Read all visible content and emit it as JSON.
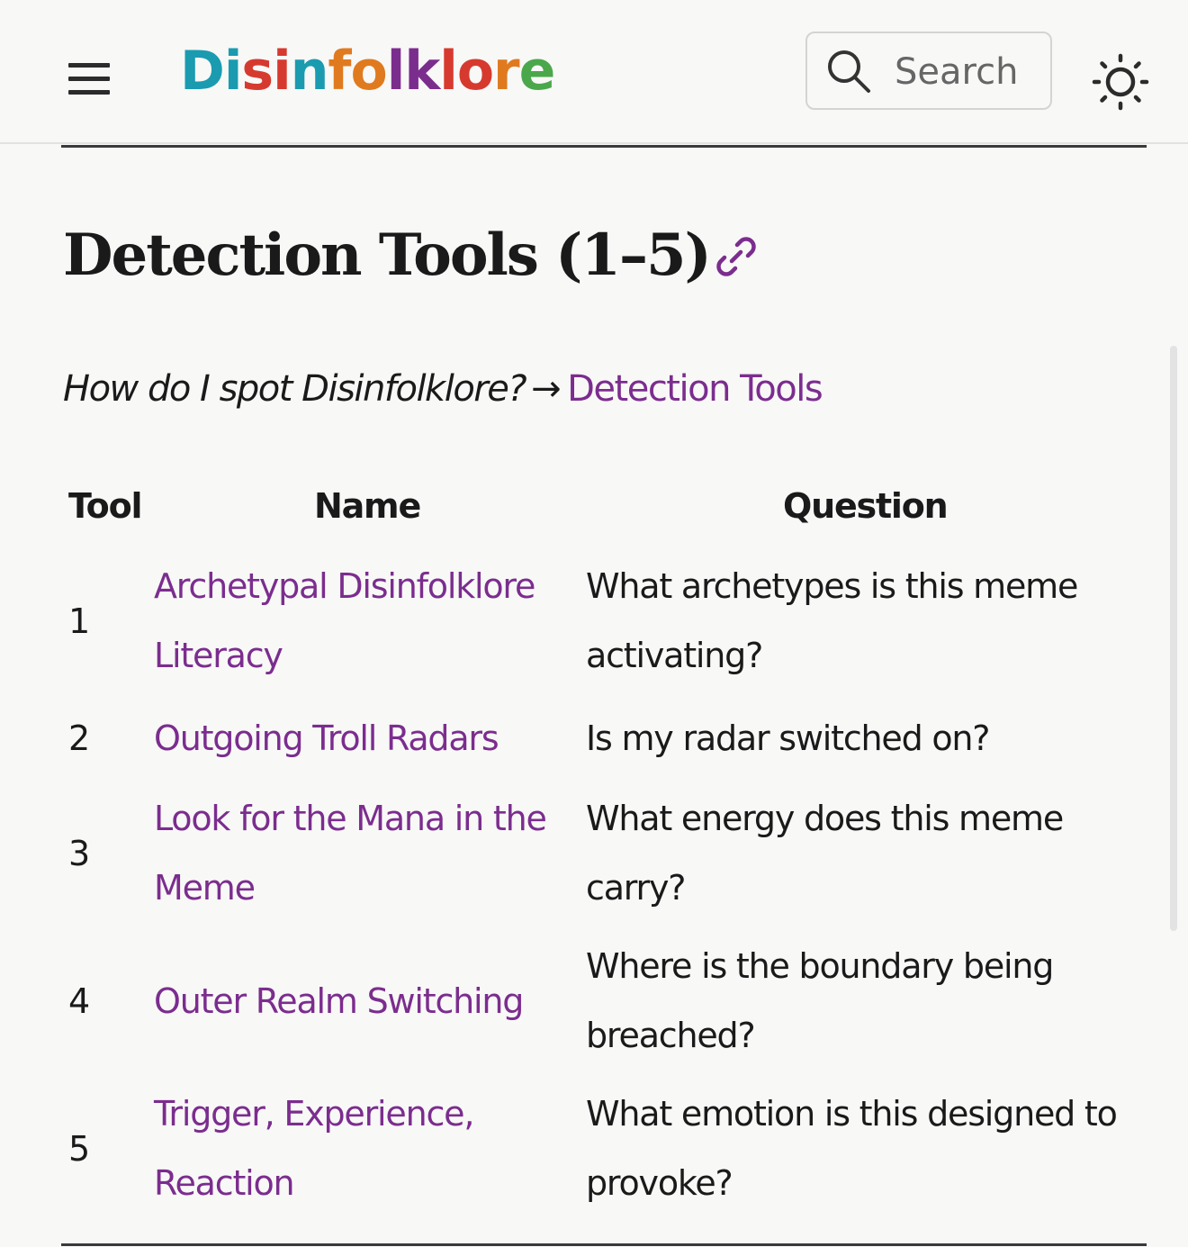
{
  "header": {
    "brand_letters": [
      {
        "ch": "D",
        "color": "#1a9bb0"
      },
      {
        "ch": "i",
        "color": "#1a9bb0"
      },
      {
        "ch": "s",
        "color": "#d63a2f"
      },
      {
        "ch": "i",
        "color": "#d63a2f"
      },
      {
        "ch": "n",
        "color": "#1a9bb0"
      },
      {
        "ch": "f",
        "color": "#e07a1f"
      },
      {
        "ch": "o",
        "color": "#e07a1f"
      },
      {
        "ch": "l",
        "color": "#7b2d8e"
      },
      {
        "ch": "k",
        "color": "#7b2d8e"
      },
      {
        "ch": "l",
        "color": "#d63a2f"
      },
      {
        "ch": "o",
        "color": "#d63a2f"
      },
      {
        "ch": "r",
        "color": "#e07a1f"
      },
      {
        "ch": "e",
        "color": "#4aa84b"
      }
    ],
    "search_placeholder": "Search",
    "menu_icon": "hamburger-menu-icon",
    "search_icon": "search-icon",
    "theme_icon": "sun-icon"
  },
  "page": {
    "title": "Detection Tools (1–5)",
    "anchor_icon": "link-icon",
    "breadcrumb_question": "How do I spot Disinfolklore?",
    "breadcrumb_arrow": "→",
    "breadcrumb_link": "Detection Tools"
  },
  "table": {
    "headers": [
      "Tool",
      "Name",
      "Question"
    ],
    "rows": [
      {
        "tool": "1",
        "name": [
          "Archetypal Disinfolklore",
          "Literacy"
        ],
        "question": [
          "What archetypes is this meme",
          "activating?"
        ]
      },
      {
        "tool": "2",
        "name": [
          "Outgoing Troll Radars"
        ],
        "question": [
          "Is my radar switched on?"
        ]
      },
      {
        "tool": "3",
        "name": [
          "Look for the Mana in the",
          "Meme"
        ],
        "question": [
          "What energy does this meme",
          "carry?"
        ]
      },
      {
        "tool": "4",
        "name": [
          "Outer Realm Switching"
        ],
        "question": [
          "Where is the boundary being",
          "breached?"
        ]
      },
      {
        "tool": "5",
        "name": [
          "Trigger, Experience,",
          "Reaction"
        ],
        "question": [
          "What emotion is this designed to",
          "provoke?"
        ]
      }
    ]
  },
  "colors": {
    "link": "#7b2d8e",
    "text": "#1a1a1a",
    "background": "#f8f8f7"
  }
}
